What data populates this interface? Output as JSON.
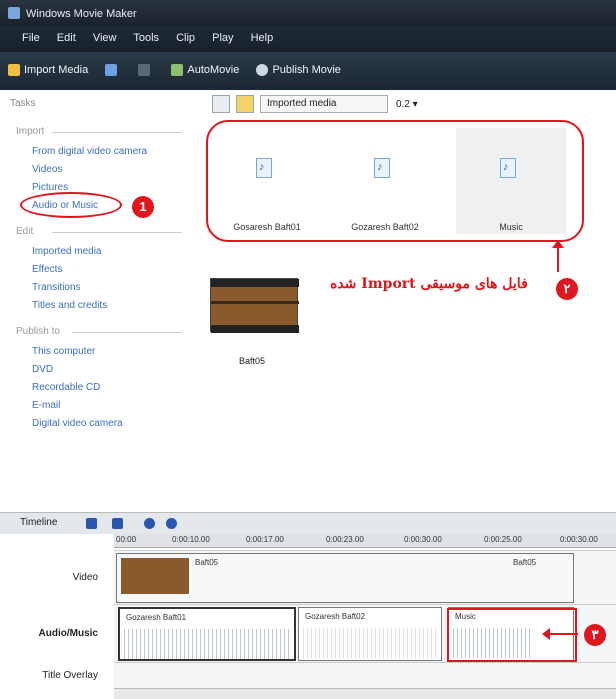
{
  "window": {
    "title": "Windows Movie Maker"
  },
  "menu": [
    "File",
    "Edit",
    "View",
    "Tools",
    "Clip",
    "Play",
    "Help"
  ],
  "toolbar": {
    "import_media": "Import Media",
    "automovie": "AutoMovie",
    "publish_movie": "Publish Movie"
  },
  "tasks": {
    "title": "Tasks",
    "import": {
      "title": "Import",
      "items": [
        "From digital video camera",
        "Videos",
        "Pictures",
        "Audio or Music"
      ]
    },
    "edit": {
      "title": "Edit",
      "items": [
        "Imported media",
        "Effects",
        "Transitions",
        "Titles and credits"
      ]
    },
    "publish": {
      "title": "Publish to",
      "items": [
        "This computer",
        "DVD",
        "Recordable CD",
        "E-mail",
        "Digital video camera"
      ]
    }
  },
  "collection": {
    "dropdown": "Imported media",
    "zoom": "0.2 ▾"
  },
  "files": [
    {
      "label": "Gosaresh Baft01"
    },
    {
      "label": "Gozaresh Baft02"
    },
    {
      "label": "Music"
    }
  ],
  "video_item": {
    "label": "Baft05"
  },
  "annotations": {
    "badge1": "1",
    "badge2": "۲",
    "badge3": "۳",
    "import_note": "فایل های موسیقی Import شده"
  },
  "timeline": {
    "mode": "Timeline",
    "ruler": [
      "00:00",
      "0:00:10.00",
      "0:00:17.00",
      "0:00:23.00",
      "0:00:30.00",
      "0:00:25.00",
      "0:00:30.00"
    ],
    "tracks": {
      "video": {
        "label": "Video",
        "clips": [
          {
            "label": "Baft05"
          },
          {
            "label": "Baft05"
          }
        ]
      },
      "audio": {
        "label": "Audio/Music",
        "clips": [
          {
            "label": "Gozaresh Baft01"
          },
          {
            "label": "Gozaresh Baft02"
          },
          {
            "label": "Music"
          }
        ]
      },
      "title": {
        "label": "Title Overlay"
      }
    }
  },
  "colors": {
    "annotation": "#e0161e",
    "link": "#3a6fbf"
  }
}
